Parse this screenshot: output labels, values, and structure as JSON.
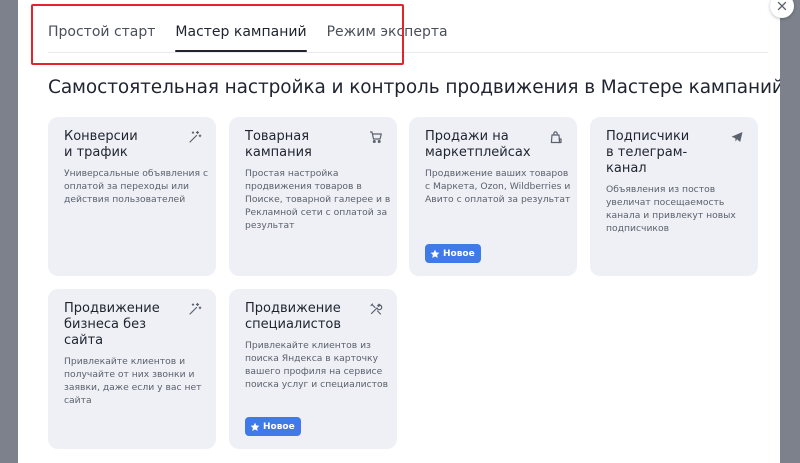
{
  "tabs": [
    {
      "label": "Простой старт",
      "active": false
    },
    {
      "label": "Мастер кампаний",
      "active": true
    },
    {
      "label": "Режим эксперта",
      "active": false
    }
  ],
  "heading": "Самостоятельная настройка и контроль продвижения в Мастере кампаний",
  "cards": [
    {
      "title": "Конверсии и трафик",
      "title_lines": [
        "Конверсии",
        "и трафик"
      ],
      "description": "Универсальные объявления с оплатой за переходы или действия пользователей",
      "icon": "magic-wand-icon",
      "badge": ""
    },
    {
      "title": "Товарная кампания",
      "title_lines": [
        "Товарная",
        "кампания"
      ],
      "description": "Простая настройка продвижения товаров в Поиске, товарной галерее и в Рекламной сети с оплатой за результат",
      "icon": "cart-icon",
      "badge": ""
    },
    {
      "title": "Продажи на маркетплейсах",
      "title_lines": [
        "Продажи на",
        "маркетплейсах"
      ],
      "description": "Продвижение ваших товаров с Маркета, Ozon, Wildberries и Авито с оплатой за результат",
      "icon": "shopping-bag-icon",
      "badge": "Новое"
    },
    {
      "title": "Подписчики в телеграм-канал",
      "title_lines": [
        "Подписчики",
        "в телеграм-канал"
      ],
      "description": "Объявления из постов увеличат посещаемость канала и привлекут новых подписчиков",
      "icon": "paper-plane-icon",
      "badge": ""
    },
    {
      "title": "Продвижение бизнеса без сайта",
      "title_lines": [
        "Продвижение",
        "бизнеса без сайта"
      ],
      "description": "Привлекайте клиентов и получайте от них звонки и заявки, даже если у вас нет сайта",
      "icon": "magic-wand-icon",
      "badge": ""
    },
    {
      "title": "Продвижение специалистов",
      "title_lines": [
        "Продвижение",
        "специалистов"
      ],
      "description": "Привлекайте клиентов из поиска Яндекса в карточку вашего профиля на сервисе поиска услуг и специалистов",
      "icon": "tools-icon",
      "badge": "Новое"
    }
  ],
  "colors": {
    "accent": "#3f7ae8",
    "highlight": "#e3252b",
    "card_bg": "#eef0f5"
  }
}
